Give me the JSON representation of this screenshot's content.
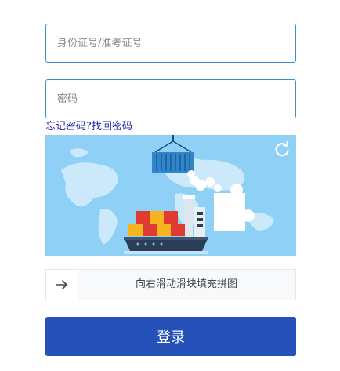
{
  "form": {
    "id_placeholder": "身份证号/准考证号",
    "password_placeholder": "密码",
    "forgot_link": "忘记密码?找回密码"
  },
  "captcha": {
    "refresh_icon": "refresh-icon",
    "slider_text": "向右滑动滑块填充拼图",
    "arrow_icon": "arrow-right-icon"
  },
  "login": {
    "button_label": "登录"
  },
  "colors": {
    "field_border": "#3e8fc4",
    "link": "#1d1da8",
    "button": "#2551b8",
    "captcha_bg": "#8fd0f7"
  }
}
